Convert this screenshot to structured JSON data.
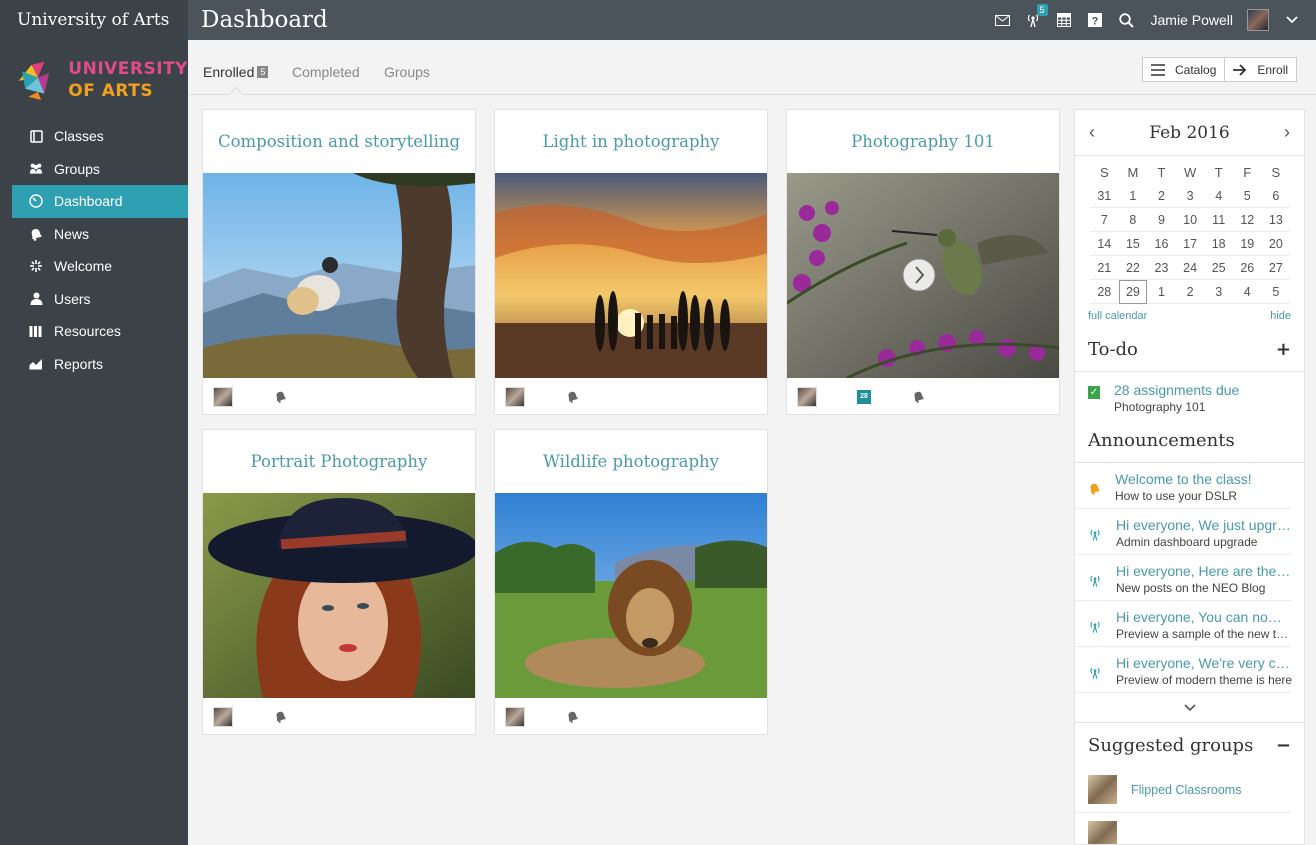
{
  "app": {
    "name": "University of Arts",
    "page_title": "Dashboard"
  },
  "logo": {
    "line1": "UNIVERSITY",
    "line2": "OF ARTS"
  },
  "topbar": {
    "notifications_count": "5",
    "username": "Jamie Powell"
  },
  "sidebar": {
    "items": [
      {
        "label": "Classes",
        "icon": "classes-icon"
      },
      {
        "label": "Groups",
        "icon": "groups-icon"
      },
      {
        "label": "Dashboard",
        "icon": "dashboard-icon",
        "active": true
      },
      {
        "label": "News",
        "icon": "news-icon"
      },
      {
        "label": "Welcome",
        "icon": "welcome-icon"
      },
      {
        "label": "Users",
        "icon": "users-icon"
      },
      {
        "label": "Resources",
        "icon": "resources-icon"
      },
      {
        "label": "Reports",
        "icon": "reports-icon"
      }
    ]
  },
  "tabs": {
    "enrolled": "Enrolled",
    "enrolled_count": "5",
    "completed": "Completed",
    "groups": "Groups"
  },
  "toolbar": {
    "catalog": "Catalog",
    "enroll": "Enroll"
  },
  "classes": [
    {
      "title": "Composition and storytelling"
    },
    {
      "title": "Light in photography"
    },
    {
      "title": "Photography 101",
      "calendar_badge": "28"
    },
    {
      "title": "Portrait Photography"
    },
    {
      "title": "Wildlife photography"
    }
  ],
  "calendar": {
    "month": "Feb 2016",
    "dow": [
      "S",
      "M",
      "T",
      "W",
      "T",
      "F",
      "S"
    ],
    "days": [
      "31",
      "1",
      "2",
      "3",
      "4",
      "5",
      "6",
      "7",
      "8",
      "9",
      "10",
      "11",
      "12",
      "13",
      "14",
      "15",
      "16",
      "17",
      "18",
      "19",
      "20",
      "21",
      "22",
      "23",
      "24",
      "25",
      "26",
      "27",
      "28",
      "29",
      "1",
      "2",
      "3",
      "4",
      "5"
    ],
    "today": "29",
    "full_calendar": "full calendar",
    "hide": "hide"
  },
  "todo": {
    "title": "To-do",
    "item_title": "28 assignments due",
    "item_sub": "Photography 101"
  },
  "announcements": {
    "title": "Announcements",
    "items": [
      {
        "title": "Welcome to the class!",
        "sub": "How to use your DSLR",
        "icon": "bell"
      },
      {
        "title": "Hi everyone, We just upgraded",
        "sub": "Admin dashboard upgrade",
        "icon": "broadcast"
      },
      {
        "title": "Hi everyone, Here are the latest",
        "sub": "New posts on the NEO Blog",
        "icon": "broadcast"
      },
      {
        "title": "Hi everyone, You can now preview",
        "sub": "Preview a sample of the new theme",
        "icon": "broadcast"
      },
      {
        "title": "Hi everyone, We're very close",
        "sub": "Preview of modern theme is here",
        "icon": "broadcast"
      }
    ]
  },
  "suggested_groups": {
    "title": "Suggested groups",
    "items": [
      {
        "name": "Flipped Classrooms"
      }
    ]
  },
  "colors": {
    "accent": "#2f9fb2",
    "link": "#4a9aa8",
    "sidebar": "#3b4248",
    "topbar": "#4b535b"
  }
}
